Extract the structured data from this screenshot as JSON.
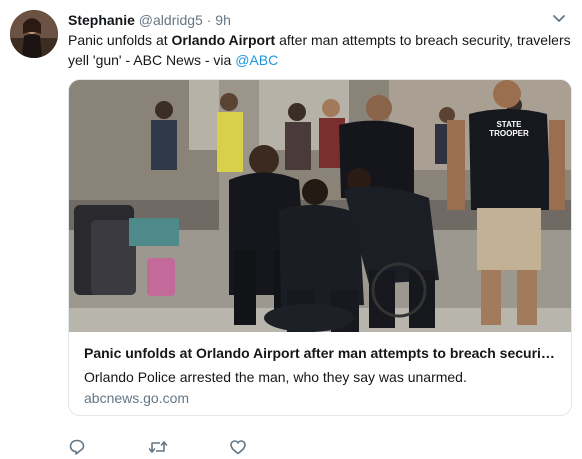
{
  "tweet": {
    "author_name": "Stephanie",
    "handle": "@aldridg5",
    "separator": "·",
    "time": "9h",
    "text_before": "Panic unfolds at ",
    "text_bold": "Orlando Airport",
    "text_after": " after man attempts to breach security, travelers yell 'gun' - ABC News -  via ",
    "mention": "@ABC"
  },
  "card": {
    "title": "Panic unfolds at Orlando Airport after man attempts to breach security, travelers yell 'gun'",
    "description": "Orlando Police arrested the man, who they say was unarmed.",
    "domain": "abcnews.go.com",
    "image_vest_text_line1": "STATE",
    "image_vest_text_line2": "TROOPER"
  },
  "actions": [
    {
      "icon": "reply-icon"
    },
    {
      "icon": "retweet-icon"
    },
    {
      "icon": "like-icon"
    }
  ],
  "colors": {
    "link": "#1b95e0",
    "secondary_text": "#657786",
    "border": "#e1e8ed"
  }
}
